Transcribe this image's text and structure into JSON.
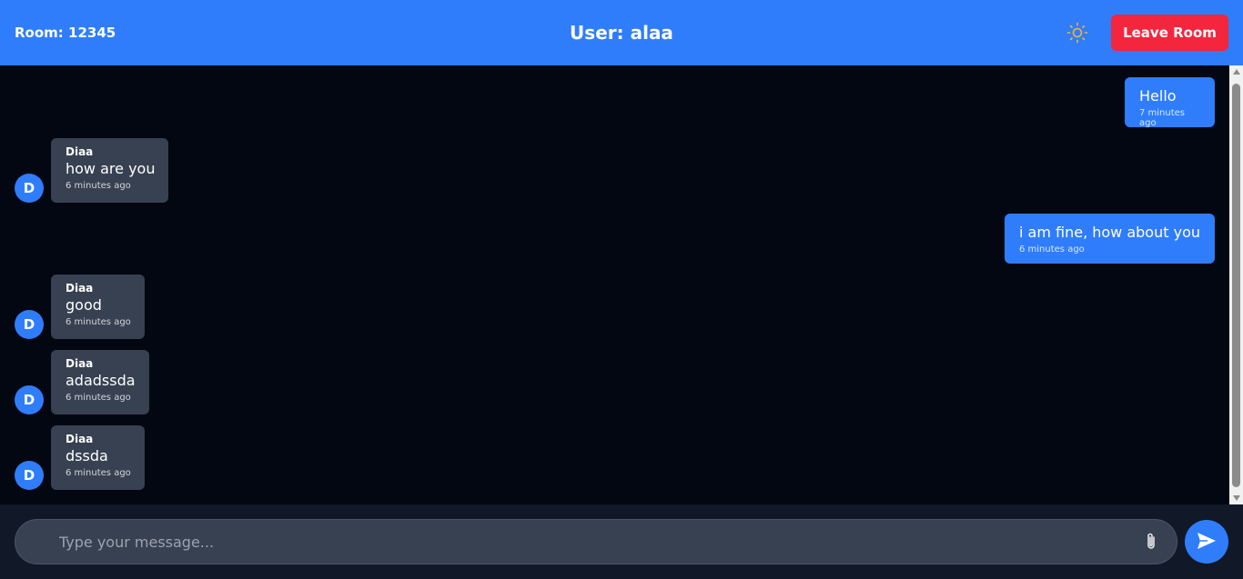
{
  "header": {
    "room": "Room: 12345",
    "user": "User: alaa",
    "theme_icon": "sun-icon",
    "leave_label": "Leave Room"
  },
  "messages": [
    {
      "own": true,
      "text": "Hello",
      "time": "7 minutes ago"
    },
    {
      "own": false,
      "sender": "Diaa",
      "avatar": "D",
      "text": "how are you",
      "time": "6 minutes ago"
    },
    {
      "own": true,
      "text": "i am fine, how about you",
      "time": "6 minutes ago"
    },
    {
      "own": false,
      "sender": "Diaa",
      "avatar": "D",
      "text": "good",
      "time": "6 minutes ago"
    },
    {
      "own": false,
      "sender": "Diaa",
      "avatar": "D",
      "text": "adadssda",
      "time": "6 minutes ago"
    },
    {
      "own": false,
      "sender": "Diaa",
      "avatar": "D",
      "text": "dssda",
      "time": "6 minutes ago"
    }
  ],
  "composer": {
    "placeholder": "Type your message...",
    "value": "",
    "attach_icon": "paperclip-icon",
    "send_icon": "send-icon"
  },
  "colors": {
    "accent": "#2f7dfb",
    "danger": "#f4263d",
    "background": "#030712",
    "bubble_incoming": "#374151"
  }
}
